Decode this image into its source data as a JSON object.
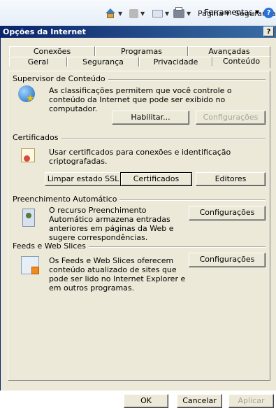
{
  "ie_toolbar": {
    "items": [
      {
        "label": ""
      },
      {
        "label": ""
      },
      {
        "label": ""
      },
      {
        "label": ""
      },
      {
        "label": "Página"
      },
      {
        "label": "Segurança"
      },
      {
        "label": "Ferramentas"
      }
    ],
    "help_label": "?"
  },
  "dialog": {
    "title": "Opções da Internet",
    "help_button_label": "?"
  },
  "tabs": {
    "row1": [
      "Conexões",
      "Programas",
      "Avançadas"
    ],
    "row2": [
      "Geral",
      "Segurança",
      "Privacidade",
      "Conteúdo"
    ],
    "active": "Conteúdo"
  },
  "content_advisor": {
    "title": "Supervisor de Conteúdo",
    "description": "As classificações permitem que você controle o conteúdo da Internet que pode ser exibido no computador.",
    "enable_button": "Habilitar...",
    "settings_button": "Configurações"
  },
  "certificates": {
    "title": "Certificados",
    "description": "Usar certificados para conexões e identificação criptografadas.",
    "clear_ssl_button": "Limpar estado SSL",
    "certificates_button": "Certificados",
    "publishers_button": "Editores"
  },
  "autocomplete": {
    "title": "Preenchimento Automático",
    "description": "O recurso Preenchimento Automático armazena entradas anteriores em páginas da Web e sugere correspondências.",
    "settings_button": "Configurações"
  },
  "feeds": {
    "title": "Feeds e Web Slices",
    "description": "Os Feeds e Web Slices oferecem conteúdo atualizado de sites que pode ser lido no Internet Explorer e em outros programas.",
    "settings_button": "Configurações"
  },
  "footer": {
    "ok": "OK",
    "cancel": "Cancelar",
    "apply": "Aplicar"
  }
}
